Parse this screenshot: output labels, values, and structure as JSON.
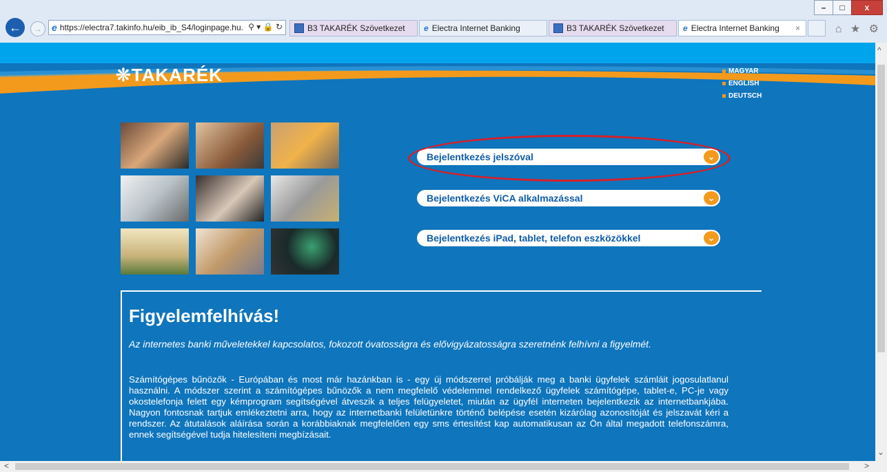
{
  "browser": {
    "address": "https://electra7.takinfo.hu/eib_ib_S4/loginpage.hu.",
    "address_tools": "⚲ ▾ 🔒 ↻",
    "tabs": [
      {
        "label": "B3 TAKARÉK Szövetkezet"
      },
      {
        "label": "Electra Internet Banking"
      },
      {
        "label": "B3 TAKARÉK Szövetkezet"
      },
      {
        "label": "Electra Internet Banking"
      }
    ],
    "tab_close": "×",
    "window": {
      "minimize": "–",
      "maximize": "□",
      "close": "x"
    },
    "right_icons": "⌂ ★ ⚙"
  },
  "header": {
    "logo": "❊TAKARÉK",
    "languages": [
      "MAGYAR",
      "ENGLISH",
      "DEUTSCH"
    ]
  },
  "login": {
    "options": [
      {
        "label": "Bejelentkezés jelszóval"
      },
      {
        "label": "Bejelentkezés ViCA alkalmazással"
      },
      {
        "label": "Bejelentkezés iPad, tablet, telefon eszközökkel"
      }
    ]
  },
  "notice": {
    "title": "Figyelemfelhívás!",
    "lead": "Az internetes banki műveletekkel kapcsolatos, fokozott óvatosságra és elővigyázatosságra szeretnénk felhívni a figyelmét.",
    "body": "Számítógépes bűnözők - Európában és most már hazánkban is - egy új módszerrel próbálják meg a banki ügyfelek számláit jogosulatlanul használni. A módszer szerint a számítógépes bűnözők a nem megfelelő védelemmel rendelkező ügyfelek számítógépe, tablet-e, PC-je vagy okostelefonja felett egy kémprogram segítségével átveszik a teljes felügyeletet, miután az ügyfél interneten bejelentkezik az internetbankjába. Nagyon fontosnak tartjuk emlékeztetni arra, hogy az internetbanki felületünkre történő belépése esetén kizárólag azonosítóját és jelszavát kéri a rendszer. Az átutalások aláírása során a korábbiaknak megfelelően egy sms értesítést kap automatikusan az Ön által megadott telefonszámra, ennek segítségével tudja hitelesíteni megbízásait."
  },
  "colors": {
    "page_bg": "#0f75bc",
    "top_band": "#00a4ec",
    "accent_orange": "#f39a1d",
    "highlight_red": "#d6202a"
  }
}
